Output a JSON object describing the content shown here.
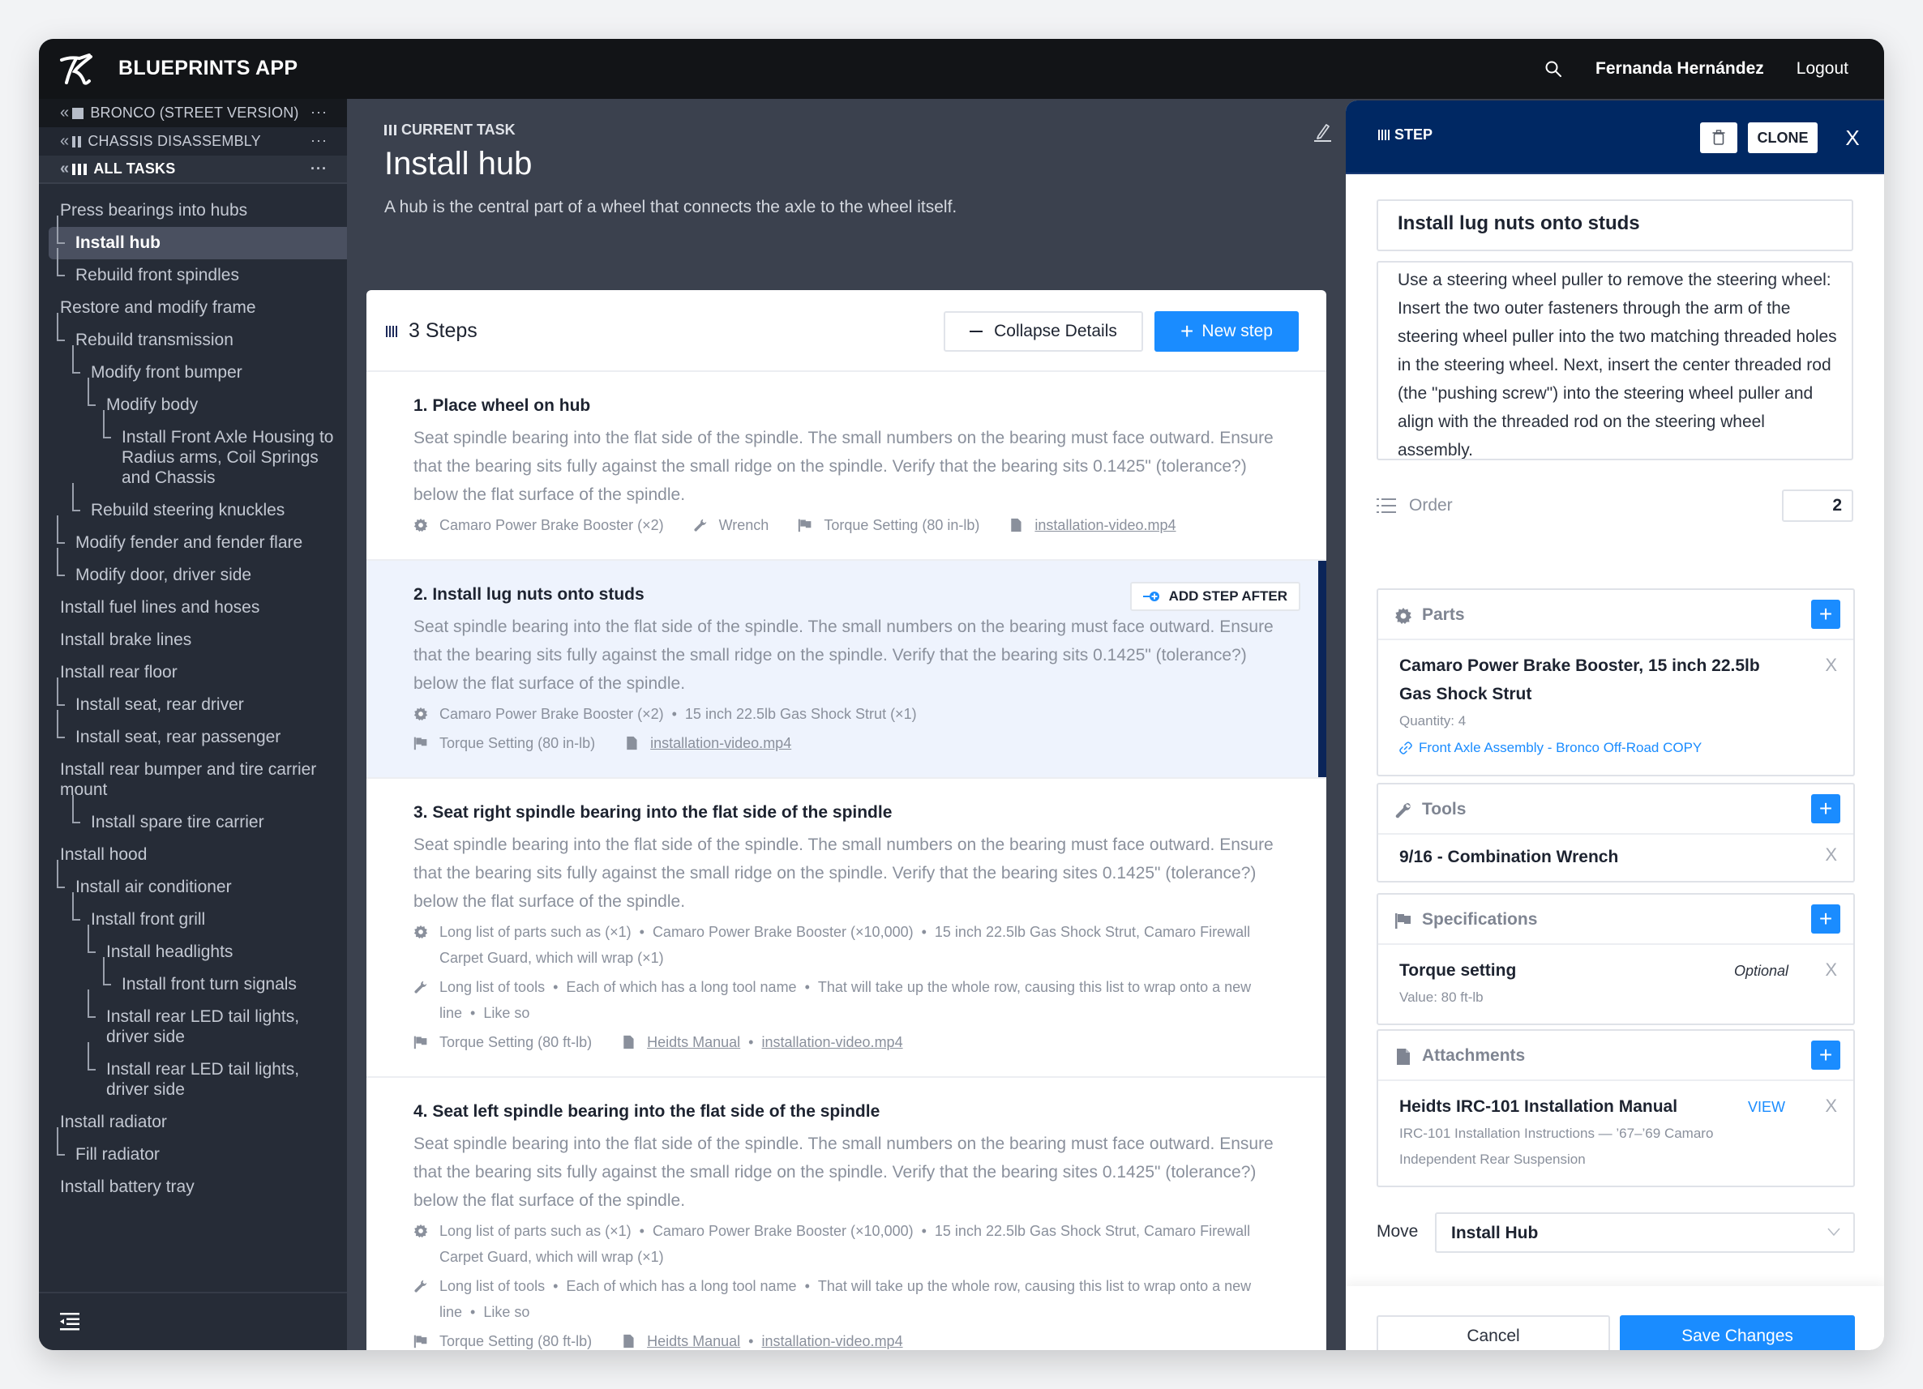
{
  "app": {
    "title": "BLUEPRINTS APP",
    "user_name": "Fernanda Hernández",
    "logout_label": "Logout"
  },
  "sidebar": {
    "breadcrumbs": [
      {
        "label": "BRONCO (STREET VERSION)",
        "menu": "···"
      },
      {
        "label": "CHASSIS DISASSEMBLY",
        "menu": "···"
      },
      {
        "label": "ALL TASKS",
        "menu": "···"
      }
    ],
    "tasks": [
      {
        "label": "Press bearings into hubs",
        "level": 0
      },
      {
        "label": "Install hub",
        "level": 1,
        "active": true
      },
      {
        "label": "Rebuild front spindles",
        "level": 1
      },
      {
        "label": "Restore and modify frame",
        "level": 0
      },
      {
        "label": "Rebuild transmission",
        "level": 1
      },
      {
        "label": "Modify front bumper",
        "level": 2
      },
      {
        "label": "Modify body",
        "level": 3
      },
      {
        "label": "Install Front Axle Housing to Radius arms, Coil Springs and Chassis",
        "level": 4
      },
      {
        "label": "Rebuild steering knuckles",
        "level": 2
      },
      {
        "label": "Modify fender and fender flare",
        "level": 1
      },
      {
        "label": "Modify door, driver side",
        "level": 1
      },
      {
        "label": "Install fuel lines and hoses",
        "level": 0
      },
      {
        "label": "Install brake lines",
        "level": 0
      },
      {
        "label": "Install rear floor",
        "level": 0
      },
      {
        "label": "Install seat, rear driver",
        "level": 1
      },
      {
        "label": "Install seat, rear passenger",
        "level": 1
      },
      {
        "label": "Install rear bumper and tire carrier mount",
        "level": 0
      },
      {
        "label": "Install spare tire carrier",
        "level": 2
      },
      {
        "label": "Install hood",
        "level": 0
      },
      {
        "label": "Install air conditioner",
        "level": 1
      },
      {
        "label": "Install front grill",
        "level": 2
      },
      {
        "label": "Install headlights",
        "level": 3
      },
      {
        "label": "Install front turn signals",
        "level": 4
      },
      {
        "label": "Install rear LED tail lights, driver side",
        "level": 3
      },
      {
        "label": "Install rear LED tail lights, driver side",
        "level": 3
      },
      {
        "label": "Install radiator",
        "level": 0
      },
      {
        "label": "Fill radiator",
        "level": 1
      },
      {
        "label": "Install battery tray",
        "level": 0
      }
    ]
  },
  "current_task": {
    "label": "CURRENT TASK",
    "title": "Install hub",
    "description": "A hub is the central part of a wheel that connects the axle to the wheel itself."
  },
  "steps_card": {
    "count_label": "3 Steps",
    "collapse_label": "Collapse Details",
    "new_step_label": "New step",
    "add_step_after_label": "ADD STEP AFTER",
    "steps": [
      {
        "title": "1. Place wheel on hub",
        "description": "Seat spindle bearing into the flat side of the spindle. The small numbers on the bearing must face outward. Ensure that the bearing sits fully against the small ridge on the spindle. Verify that the bearing sits 0.1425\" (tolerance?) below the flat surface of the spindle.",
        "parts": [
          "Camaro Power Brake Booster (×2)"
        ],
        "tools": [
          "Wrench"
        ],
        "specs": [
          "Torque Setting (80 in-lb)"
        ],
        "attachments": [
          "installation-video.mp4"
        ]
      },
      {
        "title": "2. Install lug nuts onto studs",
        "description": "Seat spindle bearing into the flat side of the spindle. The small numbers on the bearing must face outward. Ensure that the bearing sits fully against the small ridge on the spindle. Verify that the bearing sits 0.1425\" (tolerance?) below the flat surface of the spindle.",
        "parts": [
          "Camaro Power Brake Booster (×2)",
          "15 inch 22.5lb Gas Shock Strut (×1)"
        ],
        "specs": [
          "Torque Setting (80 in-lb)"
        ],
        "attachments": [
          "installation-video.mp4"
        ],
        "selected": true
      },
      {
        "title": "3. Seat right spindle bearing into the flat side of the spindle",
        "description": "Seat spindle bearing into the flat side of the spindle. The small numbers on the bearing must face outward. Ensure that the bearing sits fully against the small ridge on the spindle. Verify that the bearing sites 0.1425\" (tolerance?) below the flat surface of the spindle.",
        "parts": [
          "Long list of parts such as (×1)",
          "Camaro Power Brake Booster (×10,000)",
          "15 inch 22.5lb Gas Shock Strut, Camaro Firewall Carpet Guard, which will wrap (×1)"
        ],
        "tools": [
          "Long list of tools",
          "Each of which has a long tool name",
          "That will take up the whole row, causing this list to wrap onto a new line",
          "Like so"
        ],
        "specs": [
          "Torque Setting (80 ft-lb)"
        ],
        "attachments": [
          "Heidts Manual",
          "installation-video.mp4"
        ]
      },
      {
        "title": "4. Seat left spindle bearing into the flat side of the spindle",
        "description": "Seat spindle bearing into the flat side of the spindle. The small numbers on the bearing must face outward. Ensure that the bearing sits fully against the small ridge on the spindle. Verify that the bearing sites 0.1425\" (tolerance?) below the flat surface of the spindle.",
        "parts": [
          "Long list of parts such as (×1)",
          "Camaro Power Brake Booster (×10,000)",
          "15 inch 22.5lb Gas Shock Strut, Camaro Firewall Carpet Guard, which will wrap (×1)"
        ],
        "tools": [
          "Long list of tools",
          "Each of which has a long tool name",
          "That will take up the whole row, causing this list to wrap onto a new line",
          "Like so"
        ],
        "specs": [
          "Torque Setting (80 ft-lb)"
        ],
        "attachments": [
          "Heidts Manual",
          "installation-video.mp4"
        ]
      }
    ]
  },
  "step_panel": {
    "header_label": "STEP",
    "clone_label": "CLONE",
    "close_label": "X",
    "title_value": "Install lug nuts onto studs",
    "description_value": "Use a steering wheel puller to remove the steering wheel: Insert the two outer fasteners through the arm of the steering wheel puller into the two matching threaded holes in the steering wheel. Next, insert the center threaded rod (the \"pushing screw\") into the steering wheel puller and align with the threaded rod on the steering wheel assembly.",
    "order_label": "Order",
    "order_value": "2",
    "parts": {
      "title": "Parts",
      "items": [
        {
          "name": "Camaro Power Brake Booster, 15 inch 22.5lb Gas Shock Strut",
          "quantity": "Quantity: 4",
          "link": "Front Axle Assembly - Bronco Off-Road COPY"
        }
      ]
    },
    "tools": {
      "title": "Tools",
      "items": [
        {
          "name": "9/16 - Combination Wrench"
        }
      ]
    },
    "specifications": {
      "title": "Specifications",
      "items": [
        {
          "name": "Torque setting",
          "badge": "Optional",
          "value": "Value: 80 ft-lb"
        }
      ]
    },
    "attachments": {
      "title": "Attachments",
      "items": [
        {
          "name": "Heidts IRC-101 Installation Manual",
          "action": "VIEW",
          "description": "IRC-101 Installation Instructions — ’67–’69 Camaro Independent Rear Suspension"
        }
      ]
    },
    "remove_label": "X",
    "add_label": "+",
    "move_label": "Move",
    "move_value": "Install Hub",
    "cancel_label": "Cancel",
    "save_label": "Save Changes"
  },
  "colors": {
    "topbar": "#121417",
    "sidebar": "#262c37",
    "main_bg": "#3b414e",
    "panel_header": "#002863",
    "accent": "#1a8cff",
    "selected_step_bg": "#eef3fd"
  }
}
